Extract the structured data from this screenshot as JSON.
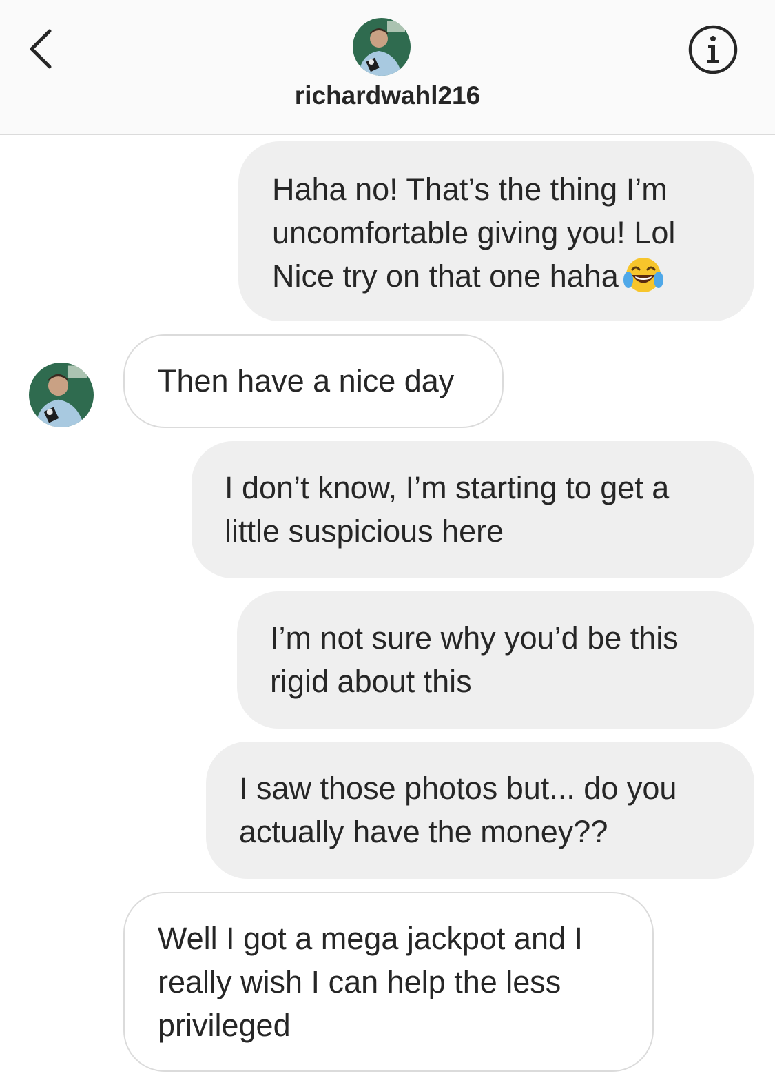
{
  "header": {
    "username": "richardwahl216",
    "back_icon": "chevron-left-icon",
    "info_icon": "info-icon"
  },
  "messages": [
    {
      "direction": "sent",
      "lines": [
        "Haha no! That’s the thing I’m",
        "uncomfortable giving you! Lol",
        "Nice try on that one haha"
      ],
      "emoji": "face-with-tears-of-joy"
    },
    {
      "direction": "received",
      "lines": [
        "Then have a nice day"
      ]
    },
    {
      "direction": "sent",
      "lines": [
        "I don’t know, I’m starting to get a",
        "little suspicious here"
      ]
    },
    {
      "direction": "sent",
      "lines": [
        "I’m not sure why you’d be this",
        "rigid about this"
      ]
    },
    {
      "direction": "sent",
      "lines": [
        "I saw those photos but... do you",
        "actually have the money??"
      ]
    },
    {
      "direction": "received",
      "lines": [
        "Well I got a mega jackpot and I",
        "really wish I can help the less",
        "privileged"
      ]
    }
  ],
  "colors": {
    "sent_bubble": "#efefef",
    "received_border": "#dbdbdb",
    "header_bg": "#fafafa",
    "text": "#262626"
  }
}
